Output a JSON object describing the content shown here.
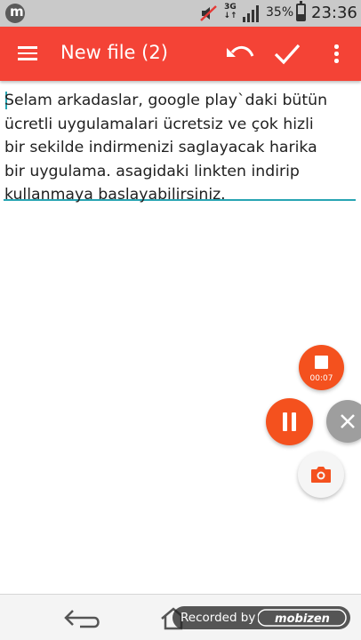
{
  "status_bar": {
    "network": "3G",
    "battery_percent": "35%",
    "battery_level": 0.35,
    "time": "23:36"
  },
  "app_bar": {
    "title": "New file (2)",
    "icons": [
      "menu-icon",
      "undo-icon",
      "check-icon",
      "more-vert-icon"
    ]
  },
  "editor": {
    "text": "Selam arkadaslar, google play`daki bütün\nücretli uygulamalari ücretsiz ve çok hizli\nbir sekilde indirmenizi saglayacak harika\nbir uygulama. asagidaki linkten indirip\nkullanmaya baslayabilirsiniz."
  },
  "recorder": {
    "timer": "00:07",
    "icons": [
      "stop-icon",
      "pause-icon",
      "close-icon",
      "camera-icon"
    ]
  },
  "navigation": {
    "icons": [
      "back-icon",
      "home-icon"
    ]
  },
  "watermark": {
    "label": "Recorded by",
    "brand": "mobizen"
  },
  "colors": {
    "accent": "#f44336",
    "recorder": "#f4511e",
    "cursor": "#27a5b3"
  }
}
